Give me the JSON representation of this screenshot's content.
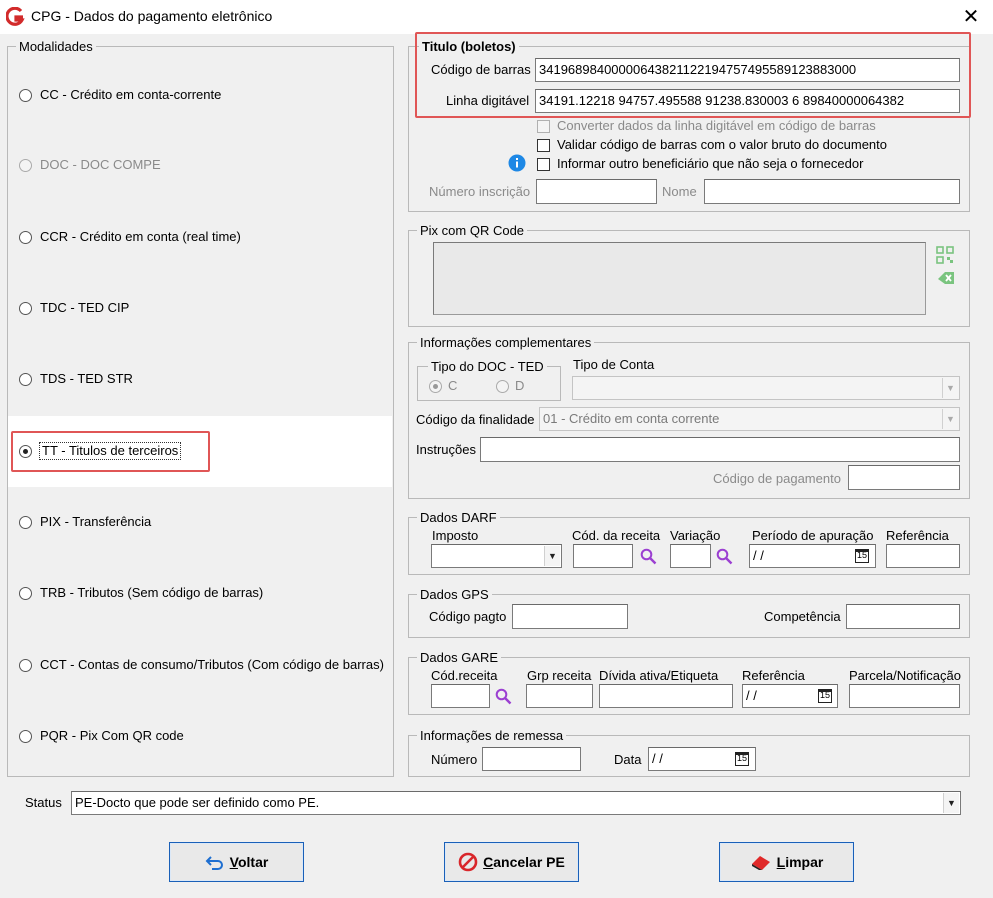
{
  "window": {
    "title": "CPG - Dados do pagamento eletrônico",
    "close_glyph": "✕"
  },
  "modalidades": {
    "label": "Modalidades",
    "items": [
      {
        "label": "CC  - Crédito em conta-corrente",
        "disabled": false,
        "checked": false
      },
      {
        "label": "DOC - DOC COMPE",
        "disabled": true,
        "checked": false
      },
      {
        "label": "CCR - Crédito em conta (real time)",
        "disabled": false,
        "checked": false
      },
      {
        "label": "TDC - TED CIP",
        "disabled": false,
        "checked": false
      },
      {
        "label": "TDS - TED STR",
        "disabled": false,
        "checked": false
      },
      {
        "label": "TT  - Titulos de terceiros",
        "disabled": false,
        "checked": true
      },
      {
        "label": "PIX - Transferência",
        "disabled": false,
        "checked": false
      },
      {
        "label": "TRB - Tributos (Sem código de barras)",
        "disabled": false,
        "checked": false
      },
      {
        "label": "CCT - Contas de consumo/Tributos (Com código de barras)",
        "disabled": false,
        "checked": false
      },
      {
        "label": "PQR - Pix Com QR code",
        "disabled": false,
        "checked": false
      }
    ]
  },
  "titulo": {
    "label": "Titulo (boletos)",
    "codigo_label": "Código de barras",
    "codigo_value": "34196898400000643821122194757495589123883000",
    "linha_label": "Linha digitável",
    "linha_value": "34191.12218 94757.495588 91238.830003 6 89840000064382",
    "chk_converter": "Converter dados da linha digitável em código de barras",
    "chk_validar": "Validar código de barras com o valor bruto do documento",
    "chk_informar": "Informar outro beneficiário que não seja o fornecedor",
    "numero_inscricao_label": "Número inscrição",
    "nome_label": "Nome"
  },
  "pix": {
    "label": "Pix com QR Code"
  },
  "complementares": {
    "label": "Informações complementares",
    "tipo_doc_label": "Tipo do DOC - TED",
    "opt_c": "C",
    "opt_d": "D",
    "tipo_conta_label": "Tipo de Conta",
    "finalidade_label": "Código da finalidade",
    "finalidade_value": "01 - Crédito em conta corrente",
    "instrucoes_label": "Instruções",
    "codigo_pagamento_label": "Código de pagamento"
  },
  "darf": {
    "label": "Dados DARF",
    "imposto": "Imposto",
    "cod_receita": "Cód. da receita",
    "variacao": "Variação",
    "periodo": "Período de apuração",
    "referencia": "Referência",
    "periodo_value": " / /"
  },
  "gps": {
    "label": "Dados GPS",
    "codigo_pagto": "Código pagto",
    "competencia": "Competência"
  },
  "gare": {
    "label": "Dados GARE",
    "cod_receita": "Cód.receita",
    "grp_receita": "Grp receita",
    "divida": "Dívida ativa/Etiqueta",
    "referencia": "Referência",
    "parcela": "Parcela/Notificação",
    "referencia_value": " / /"
  },
  "remessa": {
    "label": "Informações de remessa",
    "numero": "Número",
    "data": "Data",
    "data_value": " / /"
  },
  "status": {
    "label": "Status",
    "value": "PE-Docto  que pode ser definido como PE."
  },
  "buttons": {
    "voltar_u": "V",
    "voltar_rest": "oltar",
    "cancelar_u": "C",
    "cancelar_rest": "ancelar PE",
    "limpar_u": "L",
    "limpar_rest": "impar"
  },
  "calendar_glyph": "15",
  "colors": {
    "highlight_red": "#e05656",
    "info_blue": "#1e88e5",
    "cancel_red": "#d9262b",
    "qr_green": "#7ac47f"
  }
}
